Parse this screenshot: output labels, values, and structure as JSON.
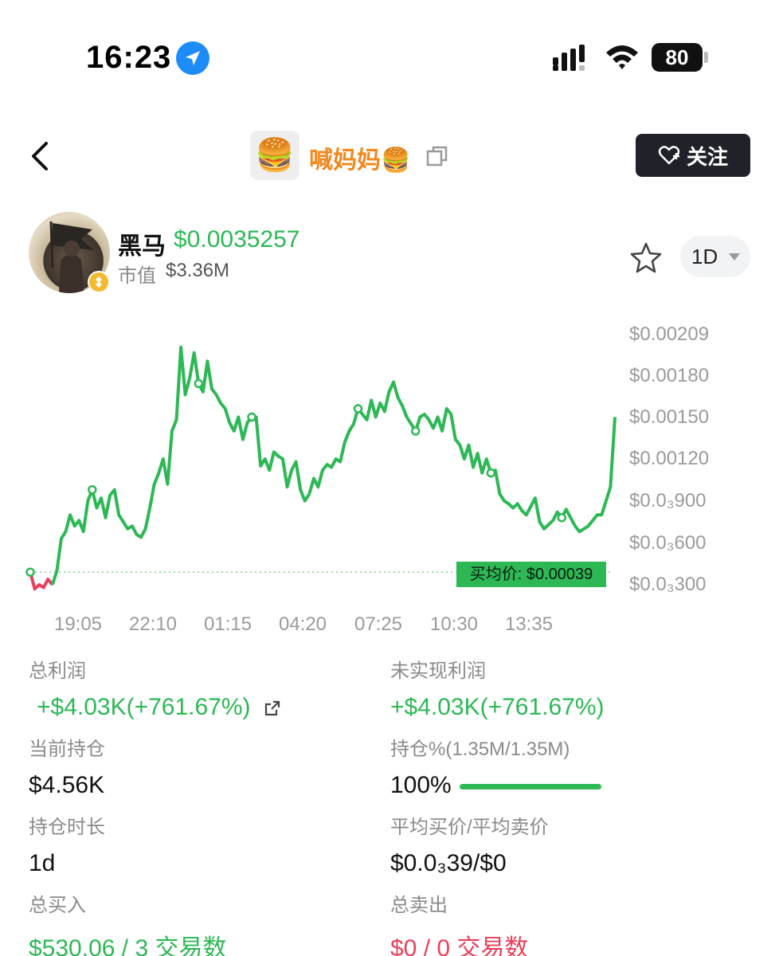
{
  "status": {
    "time": "16:23",
    "battery": "80"
  },
  "nav": {
    "avatar_emoji": "🍔",
    "title": "喊妈妈🍔",
    "follow_label": "关注"
  },
  "token": {
    "name": "黑马",
    "price": "$0.0035257",
    "mcap_label": "市值",
    "mcap_value": "$3.36M",
    "range": "1D"
  },
  "chart_data": {
    "type": "line",
    "x_ticks": [
      "19:05",
      "22:10",
      "01:15",
      "04:20",
      "07:25",
      "10:30",
      "13:35"
    ],
    "y_ticks": [
      "$0.00209",
      "$0.00180",
      "$0.00150",
      "$0.00120",
      "$0.0₃900",
      "$0.0₃600",
      "$0.0₃300"
    ],
    "avg_price_label": "买均价: $0.00039",
    "avg_price": 0.00039,
    "series": [
      {
        "values": [
          0.00039,
          0.00027,
          0.0003,
          0.00028,
          0.00034,
          0.0003,
          0.0004,
          0.00063,
          0.00068,
          0.0008,
          0.00072,
          0.00076,
          0.00068,
          0.0009,
          0.00098,
          0.00085,
          0.00092,
          0.00078,
          0.00094,
          0.00098,
          0.0008,
          0.00075,
          0.0007,
          0.00072,
          0.00066,
          0.00064,
          0.0007,
          0.00085,
          0.00102,
          0.0011,
          0.0012,
          0.00102,
          0.0014,
          0.00148,
          0.002,
          0.00166,
          0.00178,
          0.00196,
          0.00174,
          0.00168,
          0.0019,
          0.0017,
          0.00166,
          0.0016,
          0.00156,
          0.00146,
          0.0014,
          0.0015,
          0.00134,
          0.00146,
          0.0015,
          0.0015,
          0.00115,
          0.0012,
          0.00112,
          0.00125,
          0.00122,
          0.0012,
          0.001,
          0.00112,
          0.00118,
          0.00098,
          0.0009,
          0.00095,
          0.00106,
          0.001,
          0.00112,
          0.00116,
          0.00114,
          0.0012,
          0.00118,
          0.00132,
          0.0014,
          0.00145,
          0.00156,
          0.00152,
          0.00148,
          0.00162,
          0.0015,
          0.0016,
          0.00154,
          0.00168,
          0.00175,
          0.00164,
          0.00158,
          0.0015,
          0.00145,
          0.0014,
          0.0015,
          0.00152,
          0.00148,
          0.00142,
          0.0015,
          0.0014,
          0.00156,
          0.00152,
          0.00134,
          0.0013,
          0.0012,
          0.0013,
          0.00114,
          0.00124,
          0.0011,
          0.0012,
          0.0011,
          0.00112,
          0.00095,
          0.0009,
          0.00088,
          0.00085,
          0.00088,
          0.00083,
          0.0008,
          0.00086,
          0.00092,
          0.00075,
          0.0007,
          0.00073,
          0.00076,
          0.00082,
          0.00078,
          0.00084,
          0.00078,
          0.00072,
          0.00068,
          0.0007,
          0.00072,
          0.00076,
          0.0008,
          0.0008,
          0.0009,
          0.001,
          0.0015
        ]
      }
    ]
  },
  "stats": {
    "total_profit_label": "总利润",
    "total_profit_value": "+$4.03K(+761.67%)",
    "unrealized_label": "未实现利润",
    "unrealized_value": "+$4.03K(+761.67%)",
    "position_label": "当前持仓",
    "position_value": "$4.56K",
    "hold_pct_label": "持仓%(1.35M/1.35M)",
    "hold_pct_value": "100%",
    "hold_pct_fraction": 1.0,
    "duration_label": "持仓时长",
    "duration_value": "1d",
    "avg_price_label": "平均买价/平均卖价",
    "avg_price_value": "$0.0₃39/$0",
    "total_buy_label": "总买入",
    "total_buy_value": "$530.06 / 3 交易数",
    "total_sell_label": "总卖出",
    "total_sell_value": "$0 / 0 交易数"
  },
  "colors": {
    "up": "#2db855",
    "down": "#e8405a",
    "title": "#f0891e"
  }
}
